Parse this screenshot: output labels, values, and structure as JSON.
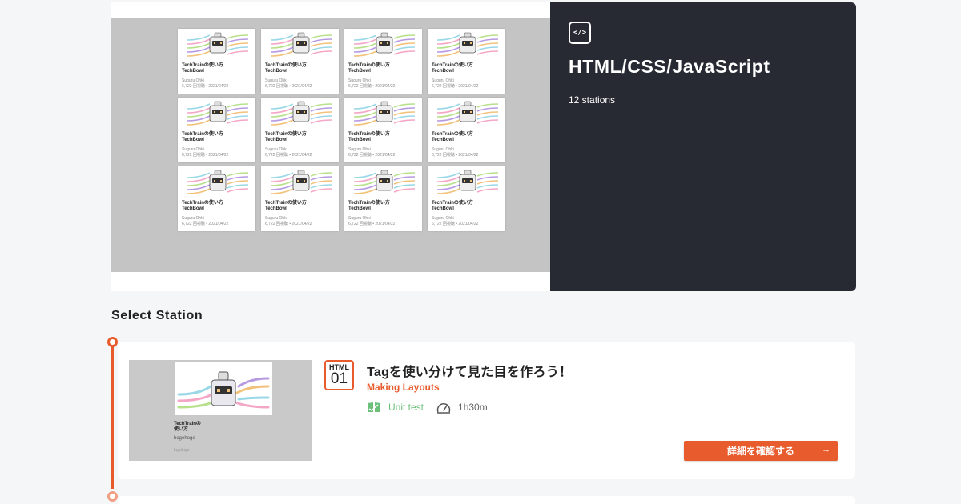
{
  "hero": {
    "title": "HTML/CSS/JavaScript",
    "stations": "12 stations",
    "icon": "code-icon",
    "preview_card": {
      "title_line1": "TechTrainの使い方",
      "title_line2": "TechBowl",
      "author": "Suguru Ohki",
      "meta": "6,722 回視聴 • 2021/04/22"
    }
  },
  "section": {
    "title": "Select Station"
  },
  "station": {
    "badge_top": "HTML",
    "badge_num": "01",
    "title": "Tagを使い分けて見た目を作ろう！",
    "subtitle": "Making Layouts",
    "unit_test": "Unit test",
    "duration": "1h30m",
    "button_label": "詳細を確認する",
    "thumb": {
      "title_line1": "TechTrainの",
      "title_line2": "使い方",
      "author": "hogehoge",
      "date": "fugafuga"
    }
  },
  "colors": {
    "accent": "#e85b2c",
    "dark": "#282a33",
    "green": "#6cc07a"
  }
}
